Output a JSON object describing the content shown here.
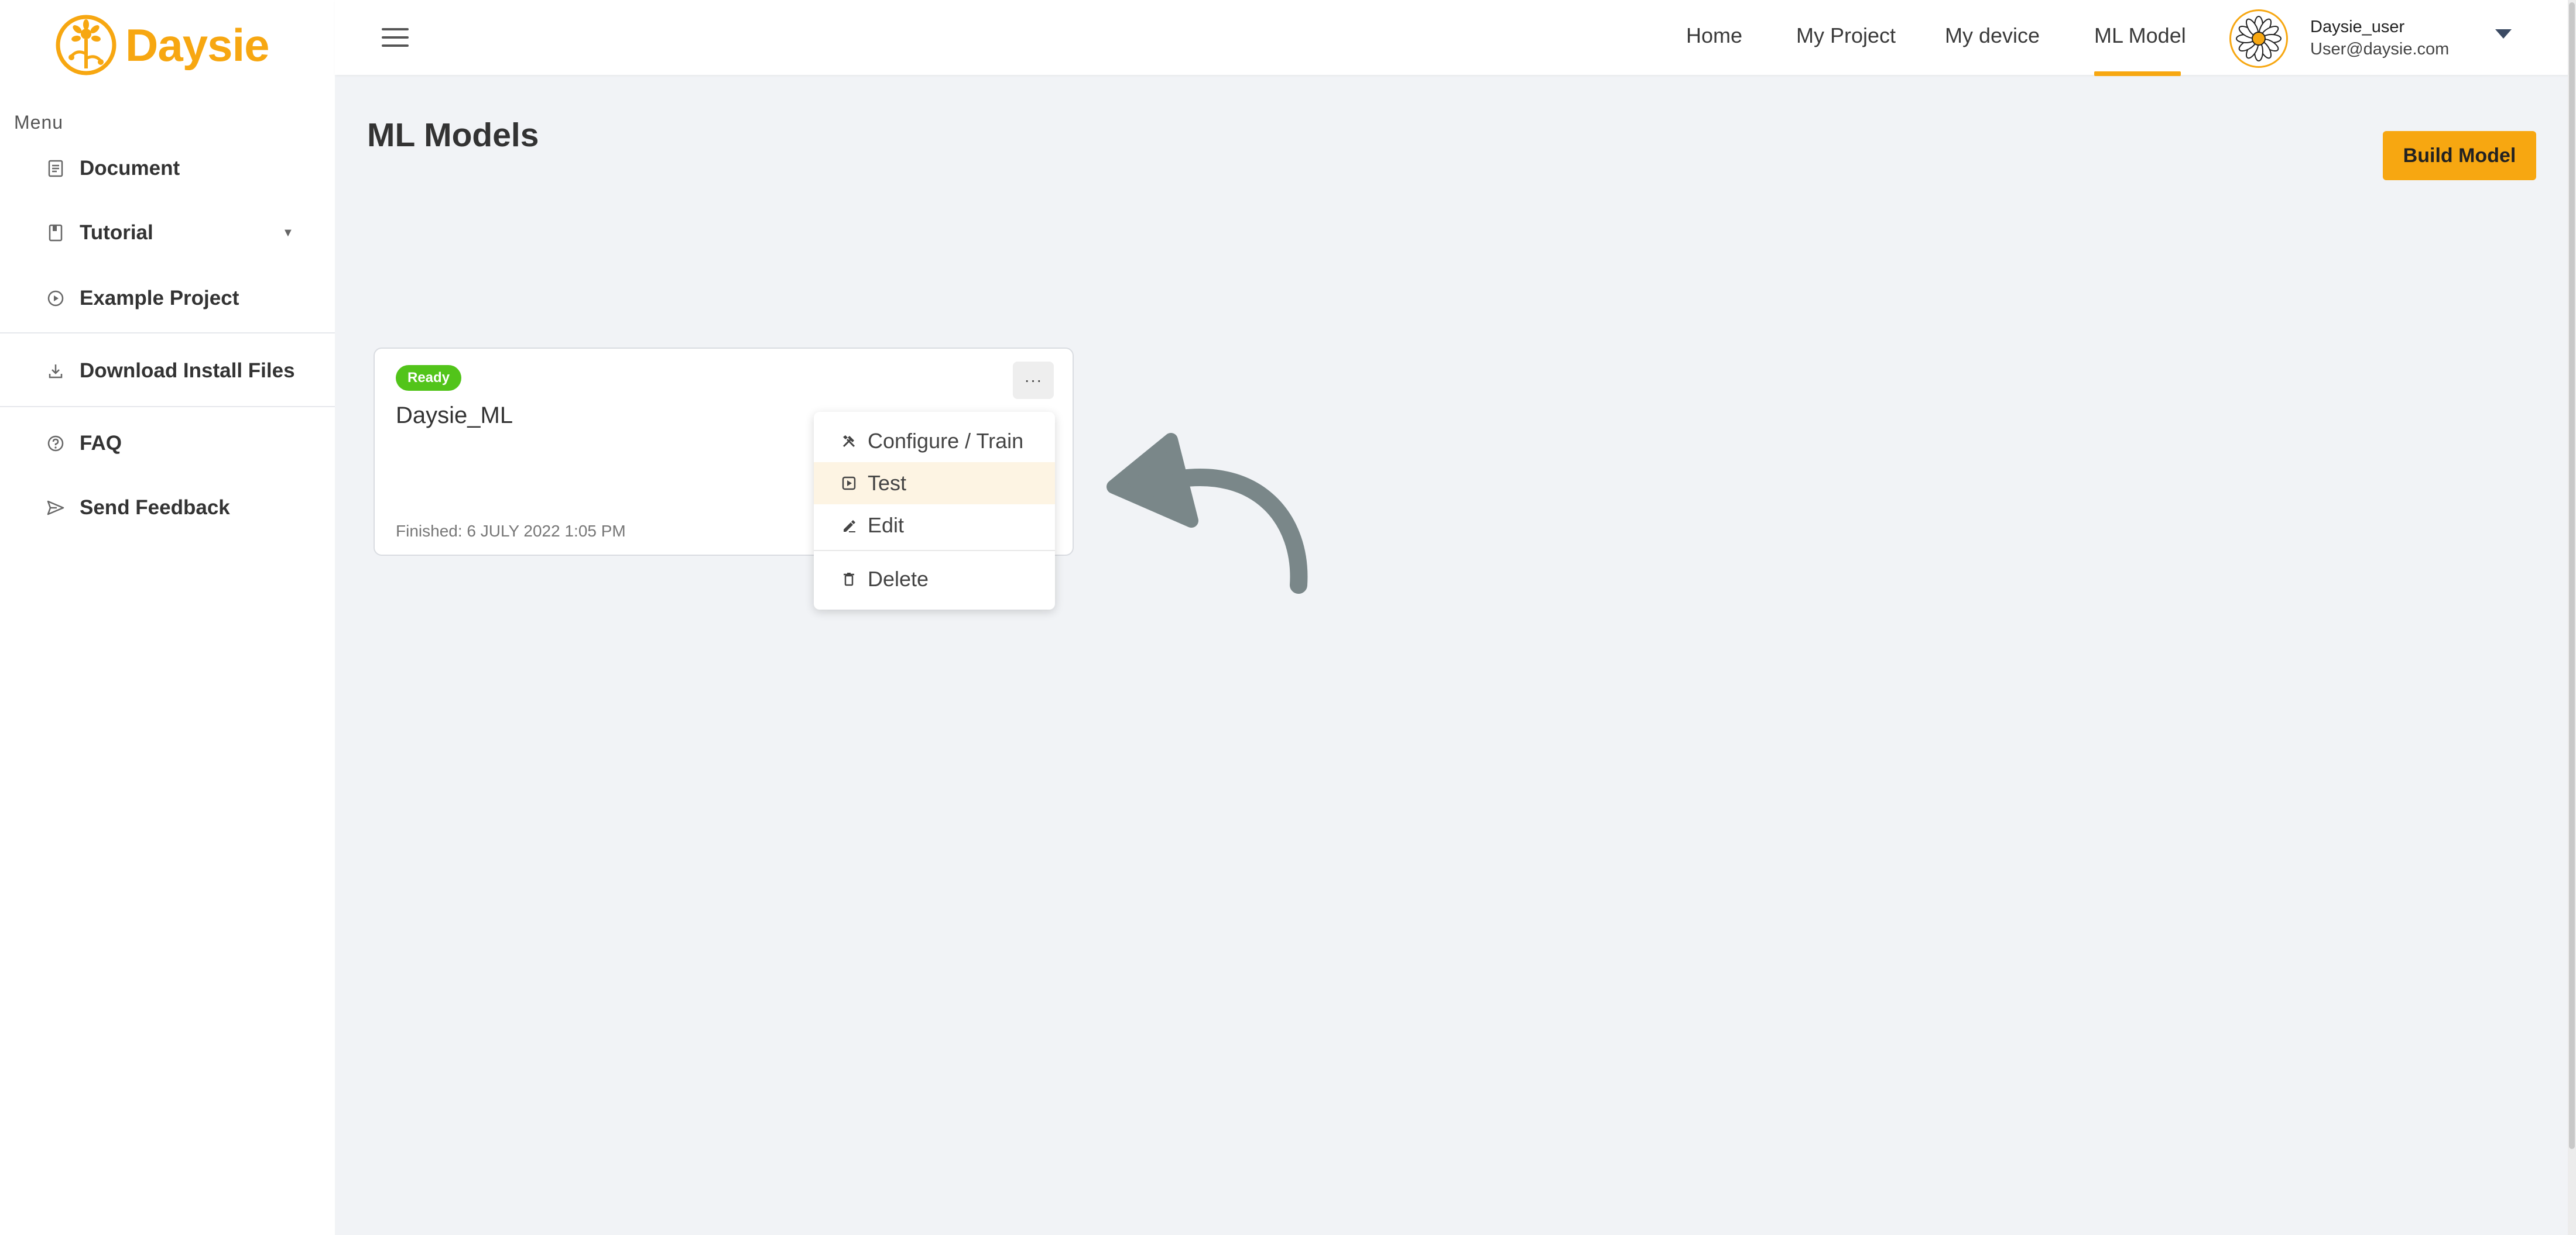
{
  "brand": {
    "name": "Daysie",
    "color": "#f7a711"
  },
  "sidebar": {
    "caption": "Menu",
    "items": [
      {
        "label": "Document",
        "icon": "document-icon"
      },
      {
        "label": "Tutorial",
        "icon": "book-icon",
        "expandable": true
      },
      {
        "label": "Example Project",
        "icon": "play-circle-icon"
      },
      {
        "label": "Download Install Files",
        "icon": "download-icon"
      },
      {
        "label": "FAQ",
        "icon": "question-circle-icon"
      },
      {
        "label": "Send Feedback",
        "icon": "send-icon"
      }
    ]
  },
  "topnav": {
    "links": [
      "Home",
      "My Project",
      "My device",
      "ML Model"
    ],
    "active": "ML Model",
    "user": {
      "name": "Daysie_user",
      "email": "User@daysie.com"
    }
  },
  "main": {
    "title": "ML Models",
    "build_button": "Build Model",
    "card": {
      "status": "Ready",
      "status_color": "#52c41a",
      "name": "Daysie_ML",
      "finished": "Finished: 6 JULY 2022 1:05 PM",
      "more_label": "···"
    },
    "menu": {
      "items": [
        {
          "label": "Configure / Train",
          "icon": "tools-icon"
        },
        {
          "label": "Test",
          "icon": "test-icon",
          "highlighted": true
        },
        {
          "label": "Edit",
          "icon": "edit-icon"
        },
        {
          "label": "Delete",
          "icon": "trash-icon"
        }
      ]
    }
  }
}
